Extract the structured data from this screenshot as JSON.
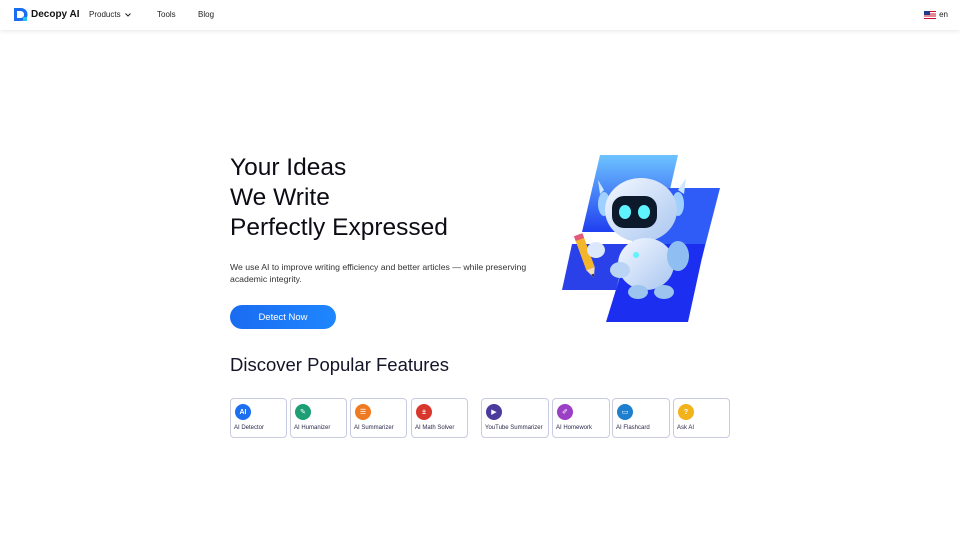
{
  "header": {
    "logo_text": "Decopy AI",
    "nav": [
      {
        "label": "Products",
        "has_dropdown": true
      },
      {
        "label": "Tools"
      },
      {
        "label": "Blog"
      }
    ],
    "language": "en"
  },
  "hero": {
    "title_lines": [
      "Your Ideas",
      "We Write",
      "Perfectly Expressed"
    ],
    "subtitle": "We use AI to improve writing efficiency and better articles — while preserving academic integrity.",
    "cta_label": "Detect Now"
  },
  "features": {
    "title": "Discover Popular Features",
    "items": [
      {
        "label": "AI Detector",
        "icon": "ai-detector-icon",
        "color": "#1d6ff2",
        "glyph": "AI"
      },
      {
        "label": "AI Humanizer",
        "icon": "ai-humanizer-icon",
        "color": "#1e9e75",
        "glyph": "✎"
      },
      {
        "label": "AI Summarizer",
        "icon": "ai-summarizer-icon",
        "color": "#f07a21",
        "glyph": "☰"
      },
      {
        "label": "AI Math Solver",
        "icon": "ai-math-solver-icon",
        "color": "#d8372c",
        "glyph": "±"
      },
      {
        "label": "YouTube Summarizer",
        "icon": "youtube-summarizer-icon",
        "color": "#4a3b9c",
        "glyph": "▶"
      },
      {
        "label": "AI Homework",
        "icon": "ai-homework-icon",
        "color": "#9b3fc4",
        "glyph": "✐"
      },
      {
        "label": "AI Flashcard",
        "icon": "ai-flashcard-icon",
        "color": "#1f7fcf",
        "glyph": "▭"
      },
      {
        "label": "Ask AI",
        "icon": "ask-ai-icon",
        "color": "#f2b21a",
        "glyph": "?"
      }
    ]
  },
  "colors": {
    "accent": "#1a6cf0",
    "text_dark": "#0c0c14",
    "card_border": "#c9cbe0"
  }
}
